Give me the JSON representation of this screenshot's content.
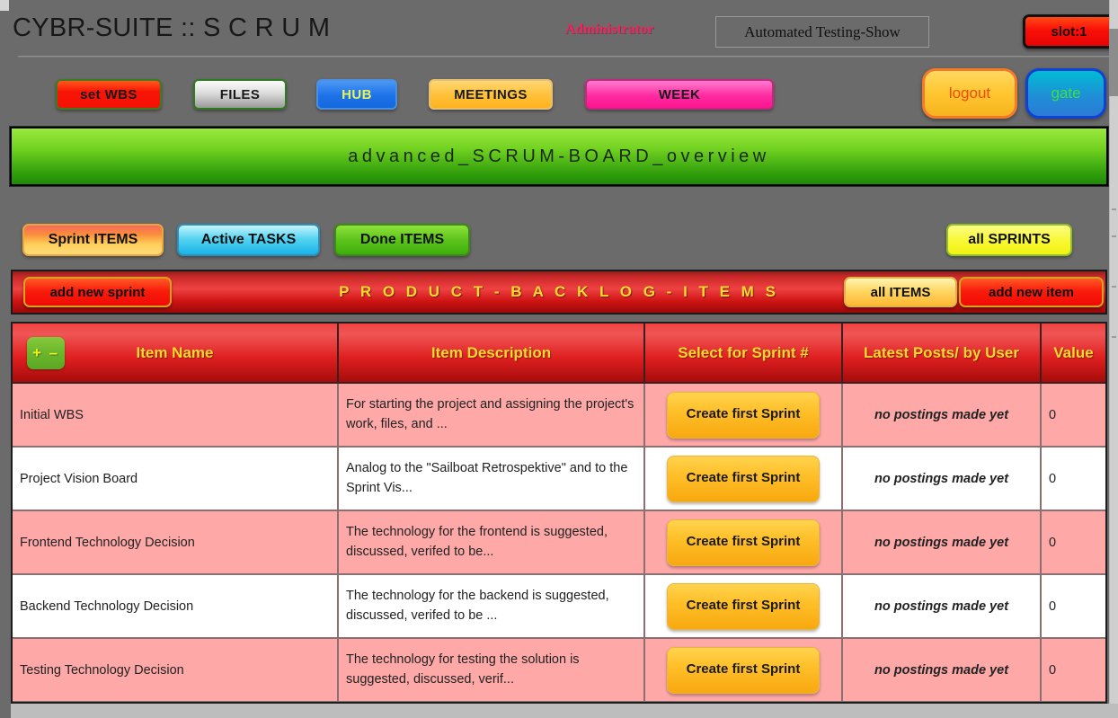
{
  "header": {
    "app_title": "CYBR-SUITE :: S C R U M",
    "role": "Administrator",
    "project_selector": "Automated Testing-Show",
    "slot": "slot:1"
  },
  "toolbar": {
    "set_wbs": "set WBS",
    "files": "FILES",
    "hub": "HUB",
    "meetings": "MEETINGS",
    "week": "WEEK",
    "logout": "logout",
    "gate": "gate"
  },
  "banner": {
    "title": "advanced_SCRUM-BOARD_overview"
  },
  "tabs": {
    "sprint_items": "Sprint ITEMS",
    "active_tasks": "Active TASKS",
    "done_items": "Done ITEMS",
    "all_sprints": "all SPRINTS"
  },
  "backlog_bar": {
    "add_new_sprint": "add new sprint",
    "title": "P R O D U C T - B A C K L O G - I T E M S",
    "all_items": "all ITEMS",
    "add_new_item": "add new item"
  },
  "table": {
    "toggle_label": "+ –",
    "columns": [
      "Item Name",
      "Item Description",
      "Select for Sprint #",
      "Latest Posts/ by User",
      "Value"
    ],
    "rows": [
      {
        "name": "Initial WBS",
        "description": "For starting the project and assigning the project's work, files, and ...",
        "sprint_action": "Create first Sprint",
        "posts": "no postings made yet",
        "value": "0"
      },
      {
        "name": "Project Vision Board",
        "description": "Analog to the \"Sailboat Retrospektive\" and to the Sprint Vis...",
        "sprint_action": "Create first Sprint",
        "posts": "no postings made yet",
        "value": "0"
      },
      {
        "name": "Frontend Technology Decision",
        "description": "The technology for the frontend is suggested, discussed, verifed to be...",
        "sprint_action": "Create first Sprint",
        "posts": "no postings made yet",
        "value": "0"
      },
      {
        "name": "Backend Technology Decision",
        "description": "The technology for the backend is suggested, discussed, verifed to be ...",
        "sprint_action": "Create first Sprint",
        "posts": "no postings made yet",
        "value": "0"
      },
      {
        "name": "Testing Technology Decision",
        "description": "The technology for testing the solution is suggested, discussed, verif...",
        "sprint_action": "Create first Sprint",
        "posts": "no postings made yet",
        "value": "0"
      }
    ]
  },
  "colors": {
    "page_background": "#6b6b6b",
    "banner_green": "#74d322",
    "backlog_red": "#ef4242",
    "header_yellow": "#ffd92e",
    "row_alt_pink": "#ffa8a8",
    "role_pink": "#f4225e"
  }
}
